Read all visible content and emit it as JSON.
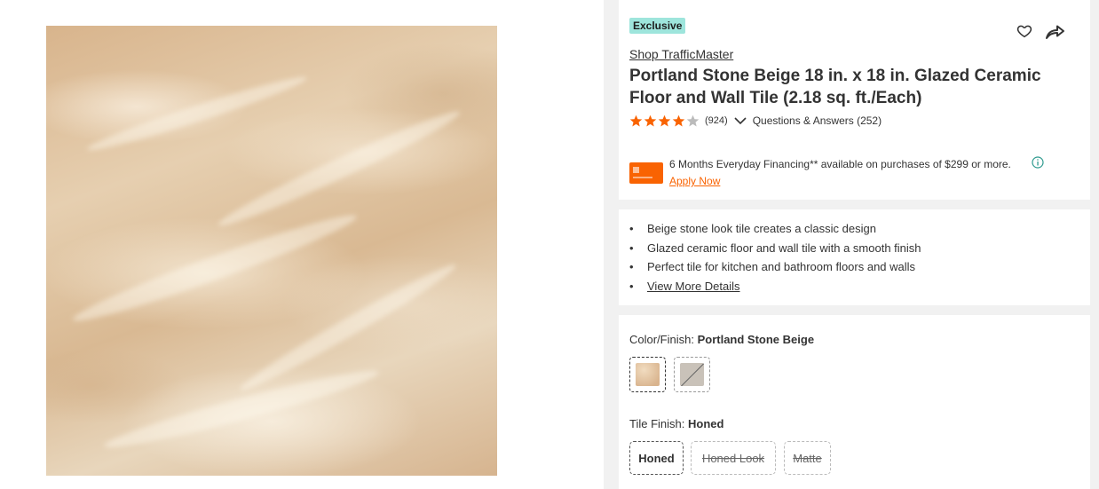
{
  "badge": "Exclusive",
  "brand_link": "Shop TrafficMaster",
  "title": "Portland Stone Beige 18 in. x 18 in. Glazed Ceramic Floor and Wall Tile (2.18 sq. ft./Each)",
  "rating": {
    "stars": 4,
    "review_count": "(924)",
    "qa_link": "Questions & Answers (252)"
  },
  "financing": {
    "text": "6 Months Everyday Financing** available on purchases of $299 or more.",
    "apply_link": "Apply Now"
  },
  "highlights": [
    "Beige stone look tile creates a classic design",
    "Glazed ceramic floor and wall tile with a smooth finish",
    "Perfect tile for kitchen and bathroom floors and walls"
  ],
  "view_more": "View More Details",
  "color": {
    "label": "Color/Finish:",
    "value": "Portland Stone Beige"
  },
  "tile_finish": {
    "label": "Tile Finish:",
    "value": "Honed",
    "options": [
      "Honed",
      "Honed Look",
      "Matte"
    ]
  },
  "colors": {
    "accent": "#f96302",
    "badge": "#9ee5dc",
    "star": "#f96302",
    "star_empty": "#bbbbbb"
  },
  "icons": [
    "heart-icon",
    "share-icon",
    "chevron-down-icon",
    "info-icon",
    "credit-card-icon",
    "star-icon"
  ]
}
